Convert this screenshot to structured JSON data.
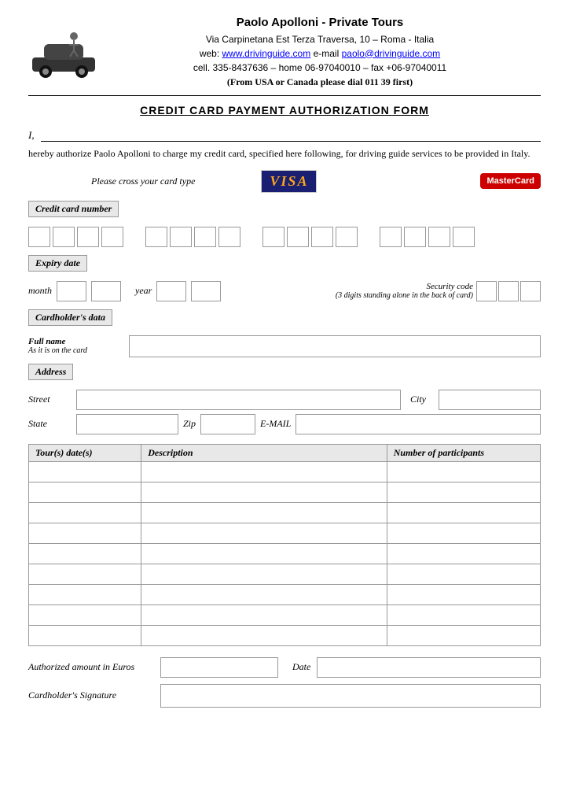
{
  "header": {
    "title": "Paolo Apolloni - Private Tours",
    "address": "Via Carpinetana Est Terza Traversa, 10 – Roma - Italia",
    "web_label": "web:",
    "web_url": "www.drivinguide.com",
    "email_label": "e-mail",
    "email": "paolo@drivinguide.com",
    "phone": "cell. 335-8437636 – home 06-97040010 – fax +06-97040011",
    "notice": "(From USA or Canada please dial 011 39 first)"
  },
  "form": {
    "title": "CREDIT CARD PAYMENT AUTHORIZATION FORM",
    "i_label": "I,",
    "authorize_text": "hereby authorize Paolo Apolloni to charge my credit card, specified here following, for driving guide services to be provided in Italy.",
    "card_type_label": "Please cross your card type",
    "visa_text": "VISA",
    "mastercard_text": "MasterCard",
    "cc_number_label": "Credit card number",
    "expiry_label": "Expiry date",
    "month_label": "month",
    "year_label": "year",
    "security_label": "Security code",
    "security_sub": "(3 digits standing alone in the back of card)",
    "cardholder_label": "Cardholder's data",
    "fullname_label": "Full name",
    "fullname_sub": "As it is on the card",
    "address_label": "Address",
    "street_label": "Street",
    "city_label": "City",
    "state_label": "State",
    "zip_label": "Zip",
    "email_field_label": "E-MAIL",
    "tours_col1": "Tour(s) date(s)",
    "tours_col2": "Description",
    "tours_col3": "Number of participants",
    "authorized_amount_label": "Authorized amount in Euros",
    "date_label": "Date",
    "signature_label": "Cardholder's Signature",
    "tour_rows": [
      {
        "date": "",
        "desc": "",
        "num": ""
      },
      {
        "date": "",
        "desc": "",
        "num": ""
      },
      {
        "date": "",
        "desc": "",
        "num": ""
      },
      {
        "date": "",
        "desc": "",
        "num": ""
      },
      {
        "date": "",
        "desc": "",
        "num": ""
      },
      {
        "date": "",
        "desc": "",
        "num": ""
      },
      {
        "date": "",
        "desc": "",
        "num": ""
      },
      {
        "date": "",
        "desc": "",
        "num": ""
      },
      {
        "date": "",
        "desc": "",
        "num": ""
      }
    ]
  }
}
